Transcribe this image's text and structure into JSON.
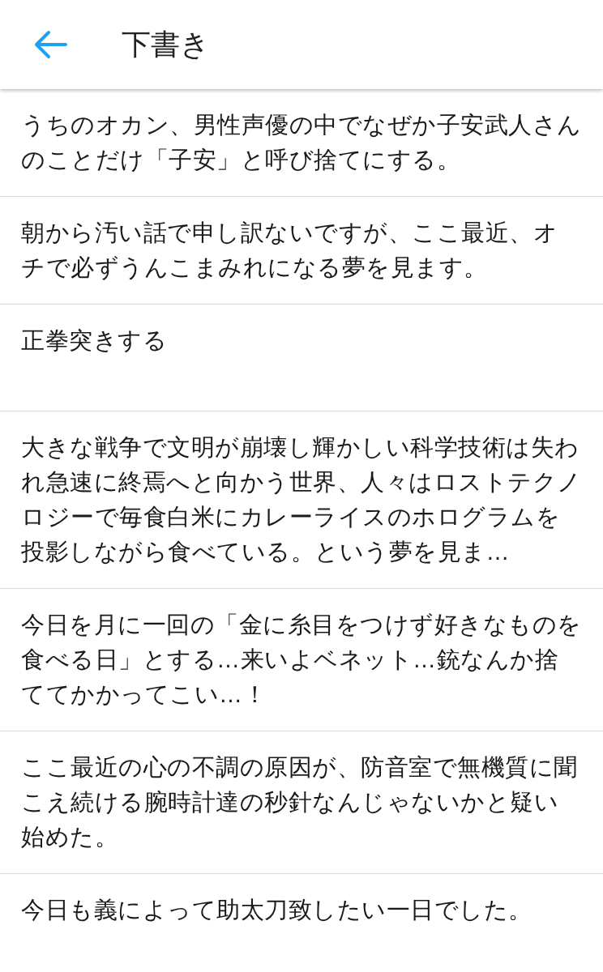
{
  "header": {
    "title": "下書き"
  },
  "drafts": [
    {
      "text": "うちのオカン、男性声優の中でなぜか子安武人さんのことだけ「子安」と呼び捨てにする。"
    },
    {
      "text": "朝から汚い話で申し訳ないですが、ここ最近、オチで必ずうんこまみれになる夢を見ます。"
    },
    {
      "text": "正拳突きする"
    },
    {
      "text": "大きな戦争で文明が崩壊し輝かしい科学技術は失われ急速に終焉へと向かう世界、人々はロストテクノロジーで毎食白米にカレーライスのホログラムを投影しながら食べている。という夢を見ま…"
    },
    {
      "text": "今日を月に一回の「金に糸目をつけず好きなものを食べる日」とする…来いよベネット…銃なんか捨ててかかってこい…！"
    },
    {
      "text": "ここ最近の心の不調の原因が、防音室で無機質に聞こえ続ける腕時計達の秒針なんじゃないかと疑い始めた。"
    },
    {
      "text": "今日も義によって助太刀致したい一日でした。"
    }
  ]
}
